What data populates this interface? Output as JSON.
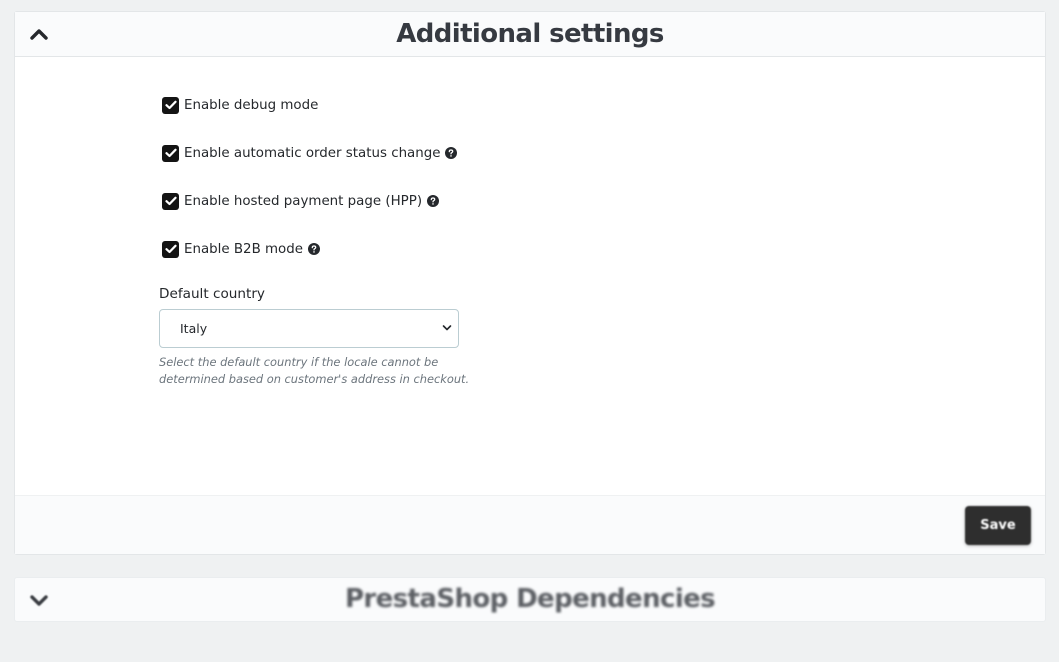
{
  "additional_settings": {
    "title": "Additional settings",
    "checkboxes": [
      {
        "label": "Enable debug mode",
        "checked": true,
        "has_help": false
      },
      {
        "label": "Enable automatic order status change",
        "checked": true,
        "has_help": true
      },
      {
        "label": "Enable hosted payment page (HPP)",
        "checked": true,
        "has_help": true
      },
      {
        "label": "Enable B2B mode",
        "checked": true,
        "has_help": true
      }
    ],
    "default_country": {
      "label": "Default country",
      "selected": "Italy",
      "help": "Select the default country if the locale cannot be determined based on customer's address in checkout."
    },
    "save_label": "Save"
  },
  "dependencies_panel": {
    "title": "PrestaShop Dependencies"
  },
  "icons": {
    "collapse": "chevron-up-icon",
    "expand": "chevron-down-icon",
    "help": "question-circle-icon",
    "check": "check-icon"
  },
  "colors": {
    "checkbox": "#141414",
    "save_button": "#2e2e2e",
    "background": "#eff1f2"
  }
}
